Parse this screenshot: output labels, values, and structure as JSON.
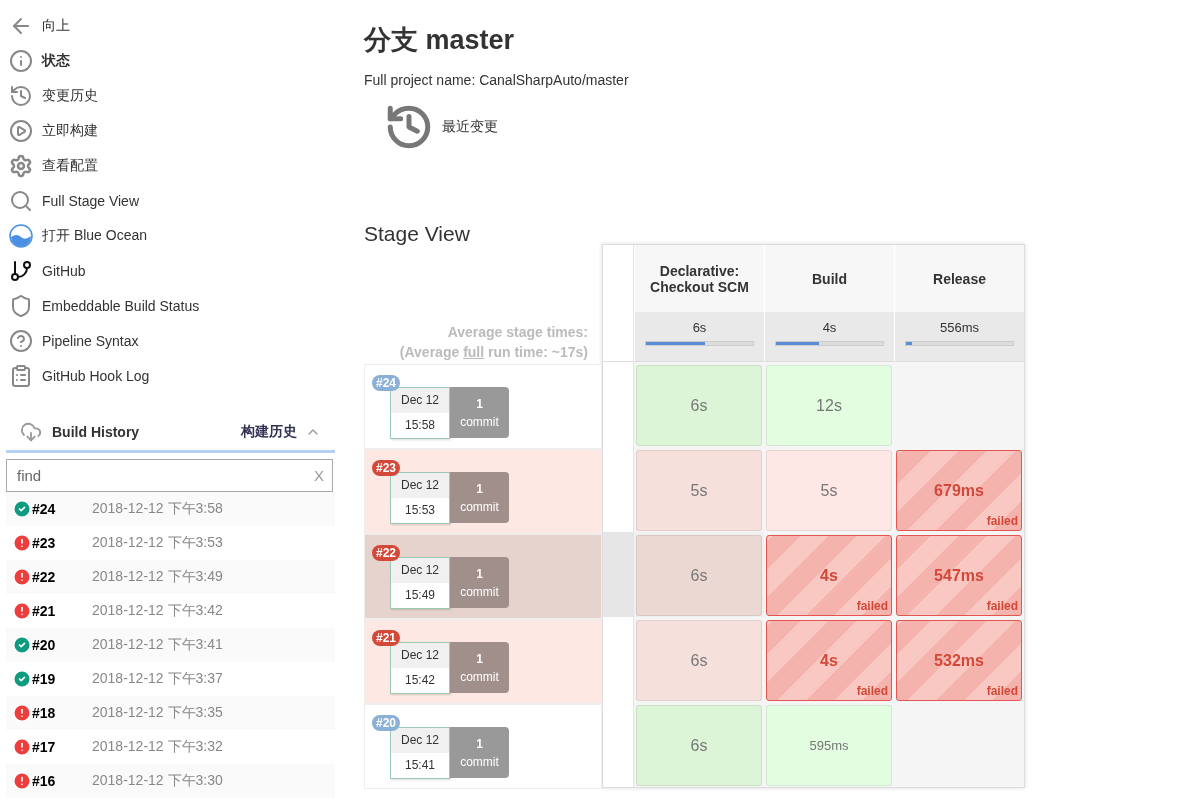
{
  "sidebar": {
    "items": [
      {
        "label": "向上",
        "selected": false
      },
      {
        "label": "状态",
        "selected": true
      },
      {
        "label": "变更历史",
        "selected": false
      },
      {
        "label": "立即构建",
        "selected": false
      },
      {
        "label": "查看配置",
        "selected": false
      },
      {
        "label": "Full Stage View",
        "selected": false
      },
      {
        "label": "打开 Blue Ocean",
        "selected": false
      },
      {
        "label": "GitHub",
        "selected": false
      },
      {
        "label": "Embeddable Build Status",
        "selected": false
      },
      {
        "label": "Pipeline Syntax",
        "selected": false
      },
      {
        "label": "GitHub Hook Log",
        "selected": false
      }
    ]
  },
  "build_history": {
    "title": "Build History",
    "link": "构建历史",
    "search": {
      "value": "find",
      "clear": "X"
    },
    "builds": [
      {
        "number": "#24",
        "failed": false,
        "time": "2018-12-12 下午3:58"
      },
      {
        "number": "#23",
        "failed": true,
        "time": "2018-12-12 下午3:53"
      },
      {
        "number": "#22",
        "failed": true,
        "time": "2018-12-12 下午3:49"
      },
      {
        "number": "#21",
        "failed": true,
        "time": "2018-12-12 下午3:42"
      },
      {
        "number": "#20",
        "failed": false,
        "time": "2018-12-12 下午3:41"
      },
      {
        "number": "#19",
        "failed": false,
        "time": "2018-12-12 下午3:37"
      },
      {
        "number": "#18",
        "failed": true,
        "time": "2018-12-12 下午3:35"
      },
      {
        "number": "#17",
        "failed": true,
        "time": "2018-12-12 下午3:32"
      },
      {
        "number": "#16",
        "failed": true,
        "time": "2018-12-12 下午3:30"
      }
    ]
  },
  "page": {
    "title": "分支 master",
    "project_name": "Full project name: CanalSharpAuto/master",
    "recent_changes": "最近变更"
  },
  "stage_view": {
    "title": "Stage View",
    "average_label": "Average stage times:",
    "average_full_prefix": "(Average ",
    "average_full_link": "full",
    "average_full_suffix": " run time: ~17s)",
    "stages": [
      {
        "name": "Declarative: Checkout SCM",
        "average": "6s",
        "level": 0.55
      },
      {
        "name": "Build",
        "average": "4s",
        "level": 0.4
      },
      {
        "name": "Release",
        "average": "556ms",
        "level": 0.06
      }
    ],
    "runs": [
      {
        "number": "#24",
        "failed": false,
        "highlighted": false,
        "date": "Dec 12",
        "time": "15:58",
        "commits": "1",
        "commits_label": "commit",
        "cells": [
          {
            "kind": "passed",
            "duration": "6s"
          },
          {
            "kind": "passed",
            "duration": "12s"
          },
          {
            "kind": "none"
          }
        ]
      },
      {
        "number": "#23",
        "failed": true,
        "highlighted": false,
        "date": "Dec 12",
        "time": "15:53",
        "commits": "1",
        "commits_label": "commit",
        "cells": [
          {
            "kind": "passed",
            "duration": "5s"
          },
          {
            "kind": "passed",
            "duration": "5s"
          },
          {
            "kind": "failed",
            "duration": "679ms",
            "label": "failed"
          }
        ]
      },
      {
        "number": "#22",
        "failed": true,
        "highlighted": true,
        "date": "Dec 12",
        "time": "15:49",
        "commits": "1",
        "commits_label": "commit",
        "cells": [
          {
            "kind": "passed",
            "duration": "6s"
          },
          {
            "kind": "failed",
            "duration": "4s",
            "label": "failed"
          },
          {
            "kind": "failed",
            "duration": "547ms",
            "label": "failed"
          }
        ]
      },
      {
        "number": "#21",
        "failed": true,
        "highlighted": false,
        "date": "Dec 12",
        "time": "15:42",
        "commits": "1",
        "commits_label": "commit",
        "cells": [
          {
            "kind": "passed",
            "duration": "6s"
          },
          {
            "kind": "failed",
            "duration": "4s",
            "label": "failed"
          },
          {
            "kind": "failed",
            "duration": "532ms",
            "label": "failed"
          }
        ]
      },
      {
        "number": "#20",
        "failed": false,
        "highlighted": false,
        "date": "Dec 12",
        "time": "15:41",
        "commits": "1",
        "commits_label": "commit",
        "cells": [
          {
            "kind": "passed",
            "duration": "6s"
          },
          {
            "kind": "passed",
            "duration": "595ms"
          },
          {
            "kind": "none"
          }
        ]
      }
    ]
  }
}
